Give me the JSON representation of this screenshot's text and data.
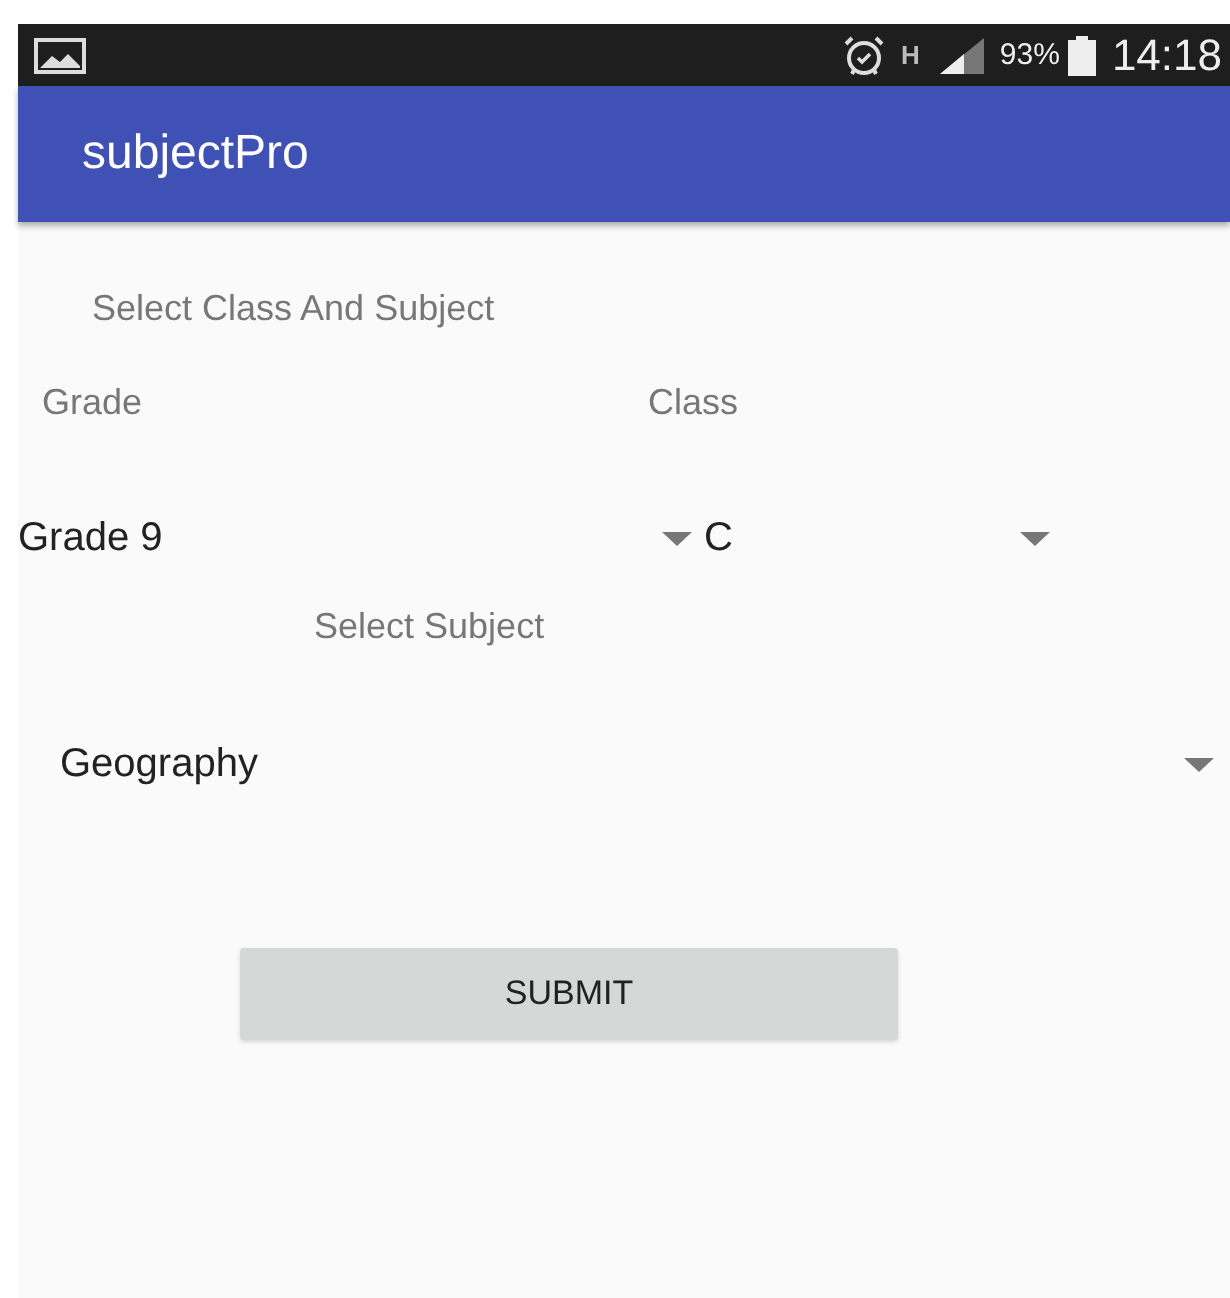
{
  "status_bar": {
    "network": "H",
    "battery": "93%",
    "time": "14:18"
  },
  "app_bar": {
    "title": "subjectPro"
  },
  "heading": "Select Class And Subject",
  "grade": {
    "label": "Grade",
    "value": "Grade 9"
  },
  "class": {
    "label": "Class",
    "value": "C"
  },
  "subject": {
    "label": "Select Subject",
    "value": "Geography"
  },
  "buttons": [
    "SUBMIT"
  ]
}
